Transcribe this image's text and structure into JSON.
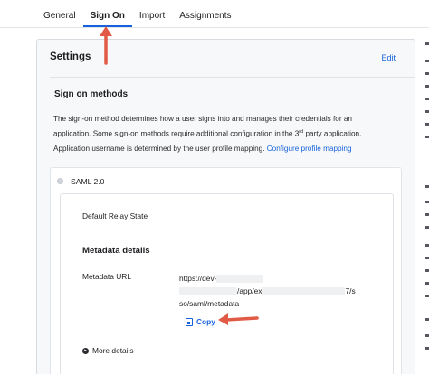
{
  "tabs": [
    {
      "label": "General"
    },
    {
      "label": "Sign On"
    },
    {
      "label": "Import"
    },
    {
      "label": "Assignments"
    }
  ],
  "panel": {
    "title": "Settings",
    "edit_label": "Edit"
  },
  "sign_on_methods": {
    "title": "Sign on methods",
    "description_1": "The sign-on method determines how a user signs into and manages their credentials for an application. Some sign-on methods require additional configuration in the 3",
    "description_sup": "rd",
    "description_2": " party application.",
    "username_text": "Application username is determined by the user profile mapping. ",
    "username_link": "Configure profile mapping"
  },
  "saml": {
    "label": "SAML 2.0",
    "relay_state_label": "Default Relay State",
    "metadata_title": "Metadata details",
    "metadata_url_label": "Metadata URL",
    "metadata_url_line1": "https://dev-",
    "metadata_url_line2_mid": "/app/ex",
    "metadata_url_line2_end": "7/s",
    "metadata_url_line3": "so/saml/metadata",
    "copy_label": "Copy",
    "more_details_label": "More details"
  },
  "colors": {
    "accent": "#1662dd",
    "annotation_arrow": "#e05a46"
  },
  "icons": {
    "copy": "copy-icon",
    "more": "chevron-right-circle-icon",
    "radio": "radio-icon"
  }
}
